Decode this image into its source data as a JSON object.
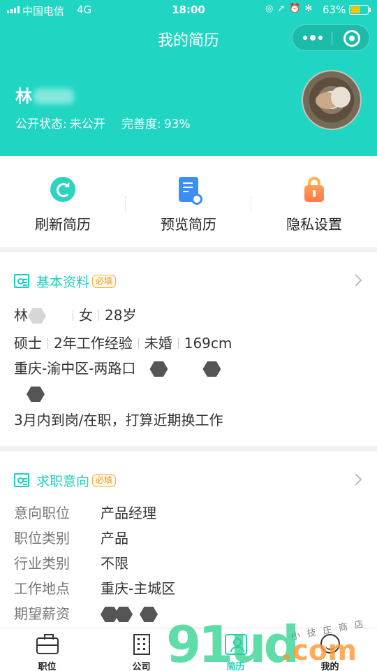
{
  "status_bar": {
    "carrier": "中国电信",
    "network": "4G",
    "time": "18:00",
    "icons": [
      "screen-lock-icon",
      "location-icon",
      "alarm-icon",
      "bluetooth-icon"
    ],
    "battery_pct": "63%",
    "battery_level": 0.63,
    "battery_color": "#f5c400"
  },
  "header": {
    "title": "我的简历",
    "name": "林",
    "public_status_label": "公开状态:",
    "public_status_value": "未公开",
    "completeness_label": "完善度:",
    "completeness_value": "93%",
    "accent": "#20d6c3"
  },
  "actions": [
    {
      "label": "刷新简历",
      "icon": "refresh-icon"
    },
    {
      "label": "预览简历",
      "icon": "preview-doc-icon"
    },
    {
      "label": "隐私设置",
      "icon": "lock-icon"
    }
  ],
  "basic": {
    "title": "基本资料",
    "badge": "必填",
    "name": "林",
    "gender": "女",
    "age": "28岁",
    "education": "硕士",
    "experience": "2年工作经验",
    "marital": "未婚",
    "height": "169cm",
    "location": "重庆-渝中区-两路口",
    "availability": "3月内到岗/在职，打算近期换工作"
  },
  "intent": {
    "title": "求职意向",
    "badge": "必填",
    "rows": [
      {
        "key": "意向职位",
        "value": "产品经理"
      },
      {
        "key": "职位类别",
        "value": "产品"
      },
      {
        "key": "行业类别",
        "value": "不限"
      },
      {
        "key": "工作地点",
        "value": "重庆-主城区"
      },
      {
        "key": "期望薪资",
        "value": ""
      }
    ]
  },
  "tabbar": {
    "items": [
      {
        "label": "职位",
        "icon": "briefcase-icon"
      },
      {
        "label": "公司",
        "icon": "building-icon"
      },
      {
        "label": "简历",
        "icon": "resume-icon"
      },
      {
        "label": "我的",
        "icon": "profile-icon"
      }
    ],
    "active": "简历"
  },
  "watermark": {
    "brand": "9",
    "brand_rest": "1ud",
    "tld": ".com",
    "tagline": "小技庄商店"
  }
}
